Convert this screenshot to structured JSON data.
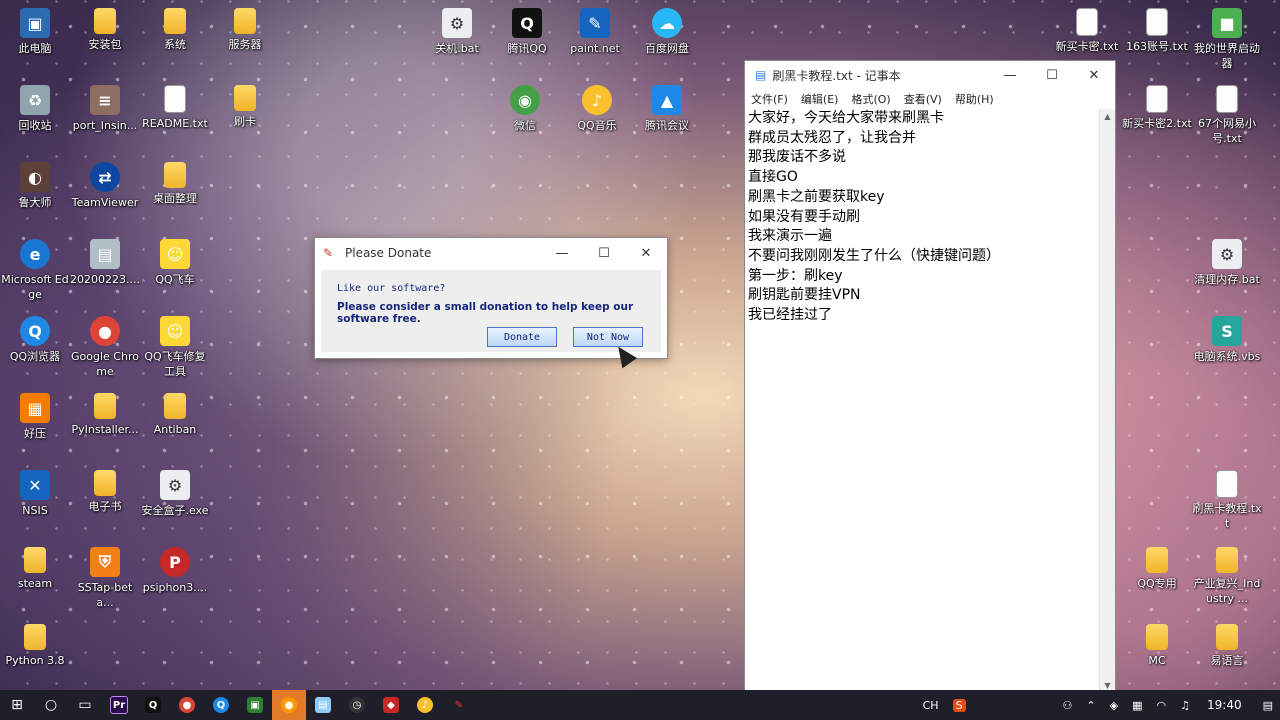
{
  "desktop": {
    "icons": [
      {
        "label": "此电脑",
        "x": 0,
        "kind": "pc"
      },
      {
        "label": "安装包",
        "kind": "folder"
      },
      {
        "label": "系统",
        "kind": "folder"
      },
      {
        "label": "服务器",
        "kind": "folder"
      },
      {
        "label": "关机.bat",
        "kind": "bat"
      },
      {
        "label": "腾讯QQ",
        "kind": "qq"
      },
      {
        "label": "paint.net",
        "kind": "paint"
      },
      {
        "label": "百度网盘",
        "kind": "baidu"
      },
      {
        "label": "回收站",
        "kind": "bin"
      },
      {
        "label": "port_Insin...",
        "kind": "rar"
      },
      {
        "label": "README.txt",
        "kind": "file"
      },
      {
        "label": "刷卡",
        "kind": "folder"
      },
      {
        "label": "微信",
        "kind": "wechat"
      },
      {
        "label": "QQ音乐",
        "kind": "qqmusic"
      },
      {
        "label": "腾讯会议",
        "kind": "meeting"
      },
      {
        "label": "鲁大师",
        "kind": "ludashi"
      },
      {
        "label": "TeamViewer",
        "kind": "tv"
      },
      {
        "label": "桌面整理",
        "kind": "folder"
      },
      {
        "label": "Microsoft Edge",
        "kind": "edge"
      },
      {
        "label": "20200223....",
        "kind": "jpg"
      },
      {
        "label": "QQ飞车",
        "kind": "qqspeed"
      },
      {
        "label": "QQ浏览器",
        "kind": "qqbrowser"
      },
      {
        "label": "Google Chrome",
        "kind": "chrome"
      },
      {
        "label": "QQ飞车修复工具",
        "kind": "qqspeed"
      },
      {
        "label": "好压",
        "kind": "haozip"
      },
      {
        "label": "PyInstaller...",
        "kind": "folder"
      },
      {
        "label": "Antiban",
        "kind": "folder"
      },
      {
        "label": "NSIS",
        "kind": "nsis"
      },
      {
        "label": "电子书",
        "kind": "folder"
      },
      {
        "label": "安全盒子.exe",
        "kind": "exe"
      },
      {
        "label": "steam",
        "kind": "folder"
      },
      {
        "label": "SSTap-beta...",
        "kind": "sstap"
      },
      {
        "label": "psiphon3....",
        "kind": "psiphon"
      },
      {
        "label": "Python 3.8",
        "kind": "folder"
      },
      {
        "label": "新买卡密.txt",
        "kind": "file"
      },
      {
        "label": "163账号.txt",
        "kind": "file"
      },
      {
        "label": "我的世界启动器",
        "kind": "mc"
      },
      {
        "label": "新买卡密2.txt",
        "kind": "file"
      },
      {
        "label": "67个网易小号.txt",
        "kind": "file"
      },
      {
        "label": "清理内存.bat",
        "kind": "bat"
      },
      {
        "label": "电脑系统.vbs",
        "kind": "vbs"
      },
      {
        "label": "刷黑卡教程.txt",
        "kind": "file"
      },
      {
        "label": "QQ专用",
        "kind": "folder"
      },
      {
        "label": "产业复兴_Industry ...",
        "kind": "folder"
      },
      {
        "label": "MC",
        "kind": "folder"
      },
      {
        "label": "易语言",
        "kind": "folder"
      }
    ]
  },
  "dialog": {
    "title": "Please Donate",
    "question": "Like our software?",
    "message": "Please consider a small donation to help keep our software free.",
    "donate_label": "Donate",
    "notnow_label": "Not Now",
    "minimize": "—",
    "maximize": "☐",
    "close": "✕"
  },
  "notepad": {
    "title": "刷黑卡教程.txt - 记事本",
    "menu": [
      "文件(F)",
      "编辑(E)",
      "格式(O)",
      "查看(V)",
      "帮助(H)"
    ],
    "lines": [
      "大家好，今天给大家带来刷黑卡",
      "群成员太残忍了，让我合并",
      "那我废话不多说",
      "直接GO",
      "刷黑卡之前要获取key",
      "如果没有要手动刷",
      "我来演示一遍",
      "不要问我刚刚发生了什么（快捷键问题）",
      "第一步：刷key",
      "刷钥匙前要挂VPN",
      "我已经挂过了"
    ]
  },
  "taskbar": {
    "clock": "19:40",
    "ime": "CH",
    "items": [
      "start",
      "search",
      "taskview",
      "premiere",
      "qq",
      "chrome",
      "qqbrowser",
      "terminal",
      "firefox",
      "notepad",
      "clock",
      "shield",
      "qqmusic",
      "feather"
    ]
  },
  "colors": {
    "dialog_text": "#16257a",
    "taskbar": "#1f1f2a",
    "active_task": "#e37a27"
  }
}
